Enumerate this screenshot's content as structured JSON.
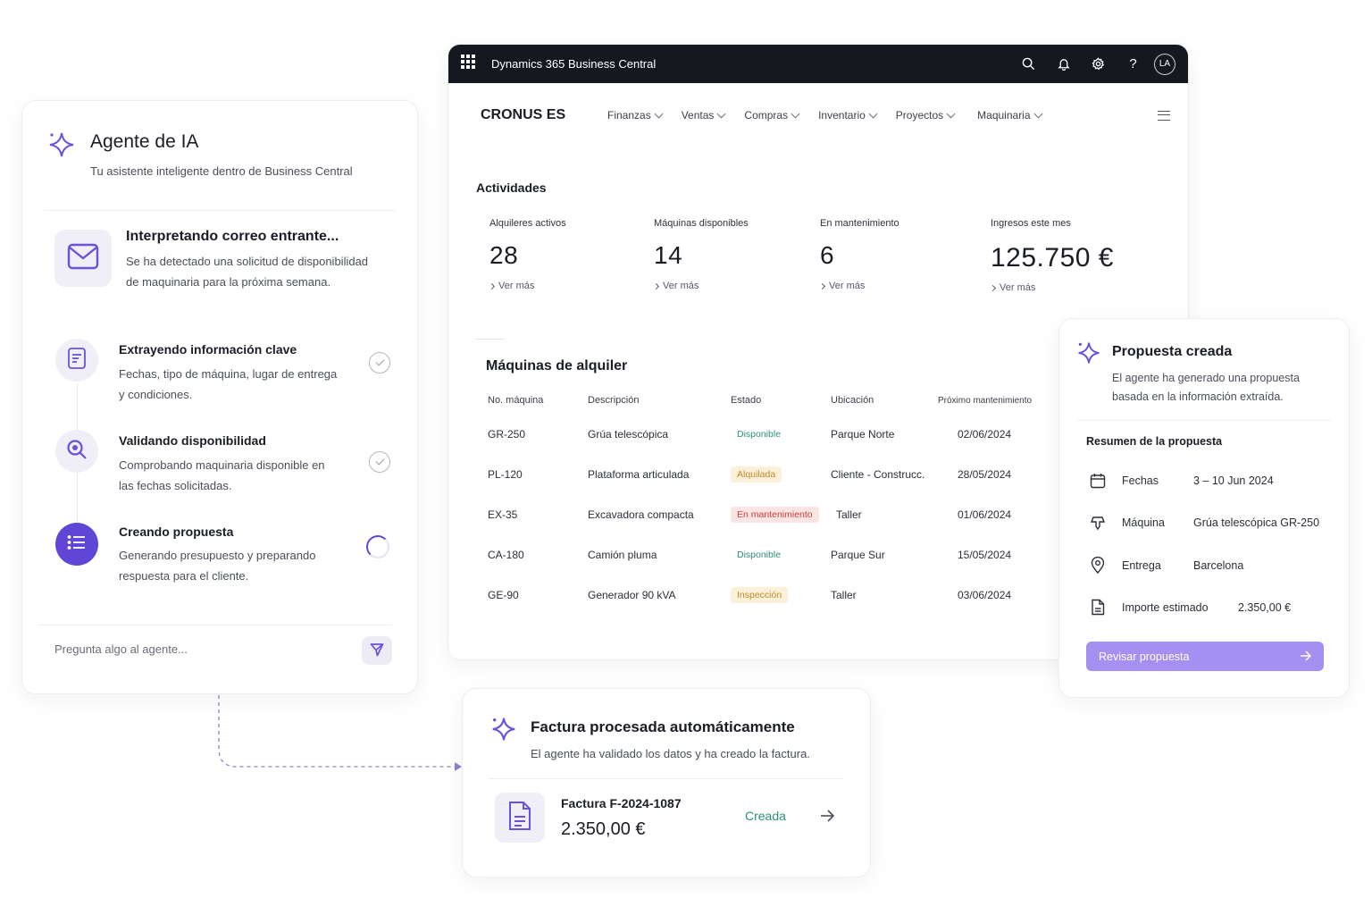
{
  "bc": {
    "app_title": "Dynamics 365 Business Central",
    "avatar_initials": "LA",
    "company": "CRONUS ES",
    "menu": [
      "Finanzas",
      "Ventas",
      "Compras",
      "Inventario",
      "Proyectos",
      "Maquinaria"
    ],
    "activities_title": "Actividades",
    "kpis": [
      {
        "label": "Alquileres activos",
        "value": "28",
        "link": "Ver más"
      },
      {
        "label": "Máquinas disponibles",
        "value": "14",
        "link": "Ver más"
      },
      {
        "label": "En mantenimiento",
        "value": "6",
        "link": "Ver más"
      },
      {
        "label": "Ingresos este mes",
        "value": "125.750 €",
        "link": "Ver más"
      }
    ],
    "rental_title": "Máquinas de alquiler",
    "columns": [
      "No. máquina",
      "Descripción",
      "Estado",
      "Ubicación",
      "Próximo mantenimiento"
    ],
    "rows": [
      {
        "id": "GR-250",
        "desc": "Grúa telescópica",
        "status": "Disponible",
        "location": "Parque Norte",
        "next": "02/06/2024"
      },
      {
        "id": "PL-120",
        "desc": "Plataforma articulada",
        "status": "Alquilada",
        "location": "Cliente - Construcc.",
        "next": "28/05/2024"
      },
      {
        "id": "EX-35",
        "desc": "Excavadora compacta",
        "status": "En mantenimiento",
        "location": "Taller",
        "next": "01/06/2024"
      },
      {
        "id": "CA-180",
        "desc": "Camión pluma",
        "status": "Disponible",
        "location": "Parque Sur",
        "next": "15/05/2024"
      },
      {
        "id": "GE-90",
        "desc": "Generador 90 kVA",
        "status": "Inspección",
        "location": "Taller",
        "next": "03/06/2024"
      }
    ]
  },
  "agent": {
    "title": "Agente de IA",
    "subtitle": "Tu asistente inteligente dentro de Business Central",
    "steps": [
      {
        "title": "Interpretando correo entrante...",
        "desc1": "Se ha detectado una solicitud de disponibilidad",
        "desc2": "de maquinaria para la próxima semana."
      },
      {
        "title": "Extrayendo información clave",
        "desc1": "Fechas, tipo de máquina, lugar de entrega",
        "desc2": "y condiciones."
      },
      {
        "title": "Validando disponibilidad",
        "desc1": "Comprobando maquinaria disponible en",
        "desc2": "las fechas solicitadas."
      },
      {
        "title": "Creando propuesta",
        "desc1": "Generando presupuesto y preparando",
        "desc2": "respuesta para el cliente."
      }
    ],
    "input_placeholder": "Pregunta algo al agente..."
  },
  "proposal": {
    "title": "Propuesta creada",
    "desc": "El agente ha generado una propuesta basada en la información extraída.",
    "summary_title": "Resumen de la propuesta",
    "items": [
      {
        "icon": "calendar-icon",
        "key": "Fechas",
        "value": "3 – 10 Jun 2024"
      },
      {
        "icon": "crane-icon",
        "key": "Máquina",
        "value": "Grúa telescópica GR-250"
      },
      {
        "icon": "location-pin-icon",
        "key": "Entrega",
        "value": "Barcelona"
      },
      {
        "icon": "document-icon",
        "key": "Importe estimado",
        "value": "2.350,00 €"
      }
    ],
    "button": "Revisar propuesta"
  },
  "invoice": {
    "title": "Factura procesada automáticamente",
    "desc": "El agente ha validado los datos y ha creado la factura.",
    "number": "Factura F-2024-1087",
    "amount": "2.350,00 €",
    "status": "Creada"
  },
  "colors": {
    "accent": "#5f46d6",
    "button": "#a390f0",
    "success": "#2f8d7a",
    "dark_bar": "#16181f"
  }
}
